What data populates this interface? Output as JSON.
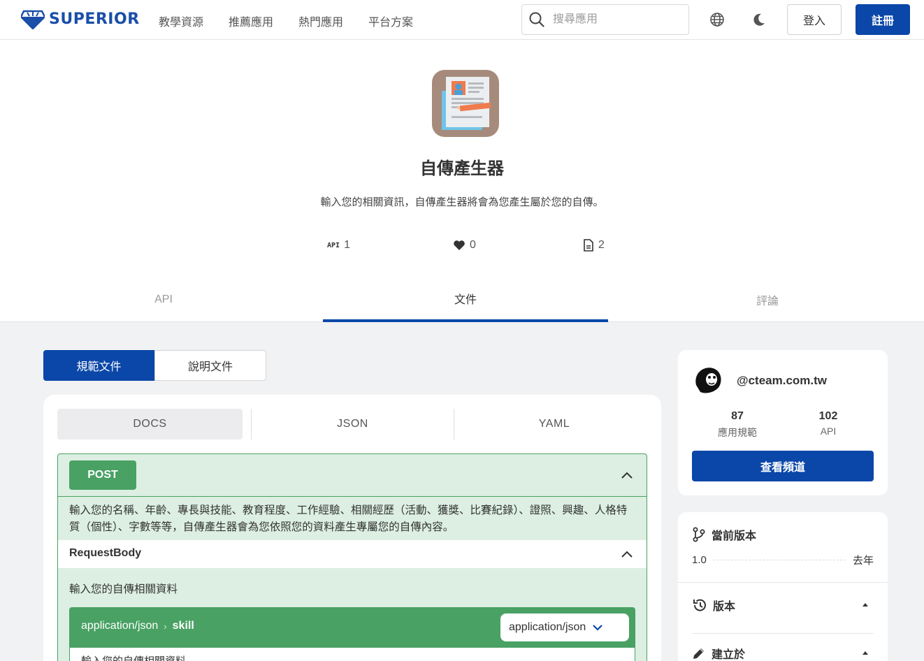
{
  "header": {
    "brand": "SUPERIOR",
    "nav": [
      "教學資源",
      "推薦應用",
      "熱門應用",
      "平台方案"
    ],
    "search_placeholder": "搜尋應用",
    "login_label": "登入",
    "register_label": "註冊"
  },
  "app": {
    "title": "自傳產生器",
    "description": "輸入您的相關資訊，自傳產生器將會為您產生屬於您的自傳。",
    "stats": {
      "api_badge": "API",
      "api_count": "1",
      "likes": "0",
      "docs": "2"
    }
  },
  "tabs": [
    "API",
    "文件",
    "評論"
  ],
  "doc_switch": {
    "spec_label": "規範文件",
    "guide_label": "說明文件"
  },
  "format_tabs": [
    "DOCS",
    "JSON",
    "YAML"
  ],
  "operation": {
    "method": "POST",
    "description": "輸入您的名稱、年齡、專長與技能、教育程度、工作經驗、相關經歷（活動、獲獎、比賽紀錄）、證照、興趣、人格特質（個性）、字數等等，自傳產生器會為您依照您的資料產生專屬您的自傳內容。",
    "request_body_title": "RequestBody",
    "request_body_desc": "輸入您的自傳相關資料",
    "media_type": "application/json",
    "schema_name": "skill",
    "media_select_value": "application/json",
    "schema_desc": "輸入您的自傳相關資料"
  },
  "owner": {
    "handle": "@cteam.com.tw",
    "specs_count": "87",
    "specs_label": "應用規範",
    "api_count": "102",
    "api_label": "API",
    "channel_button": "查看頻道"
  },
  "version_panel": {
    "current_title": "當前版本",
    "version": "1.0",
    "time": "去年",
    "versions_title": "版本",
    "created_title": "建立於"
  },
  "colors": {
    "primary": "#0a47a8",
    "post_green": "#49a164",
    "post_bg": "#dcefe2"
  }
}
